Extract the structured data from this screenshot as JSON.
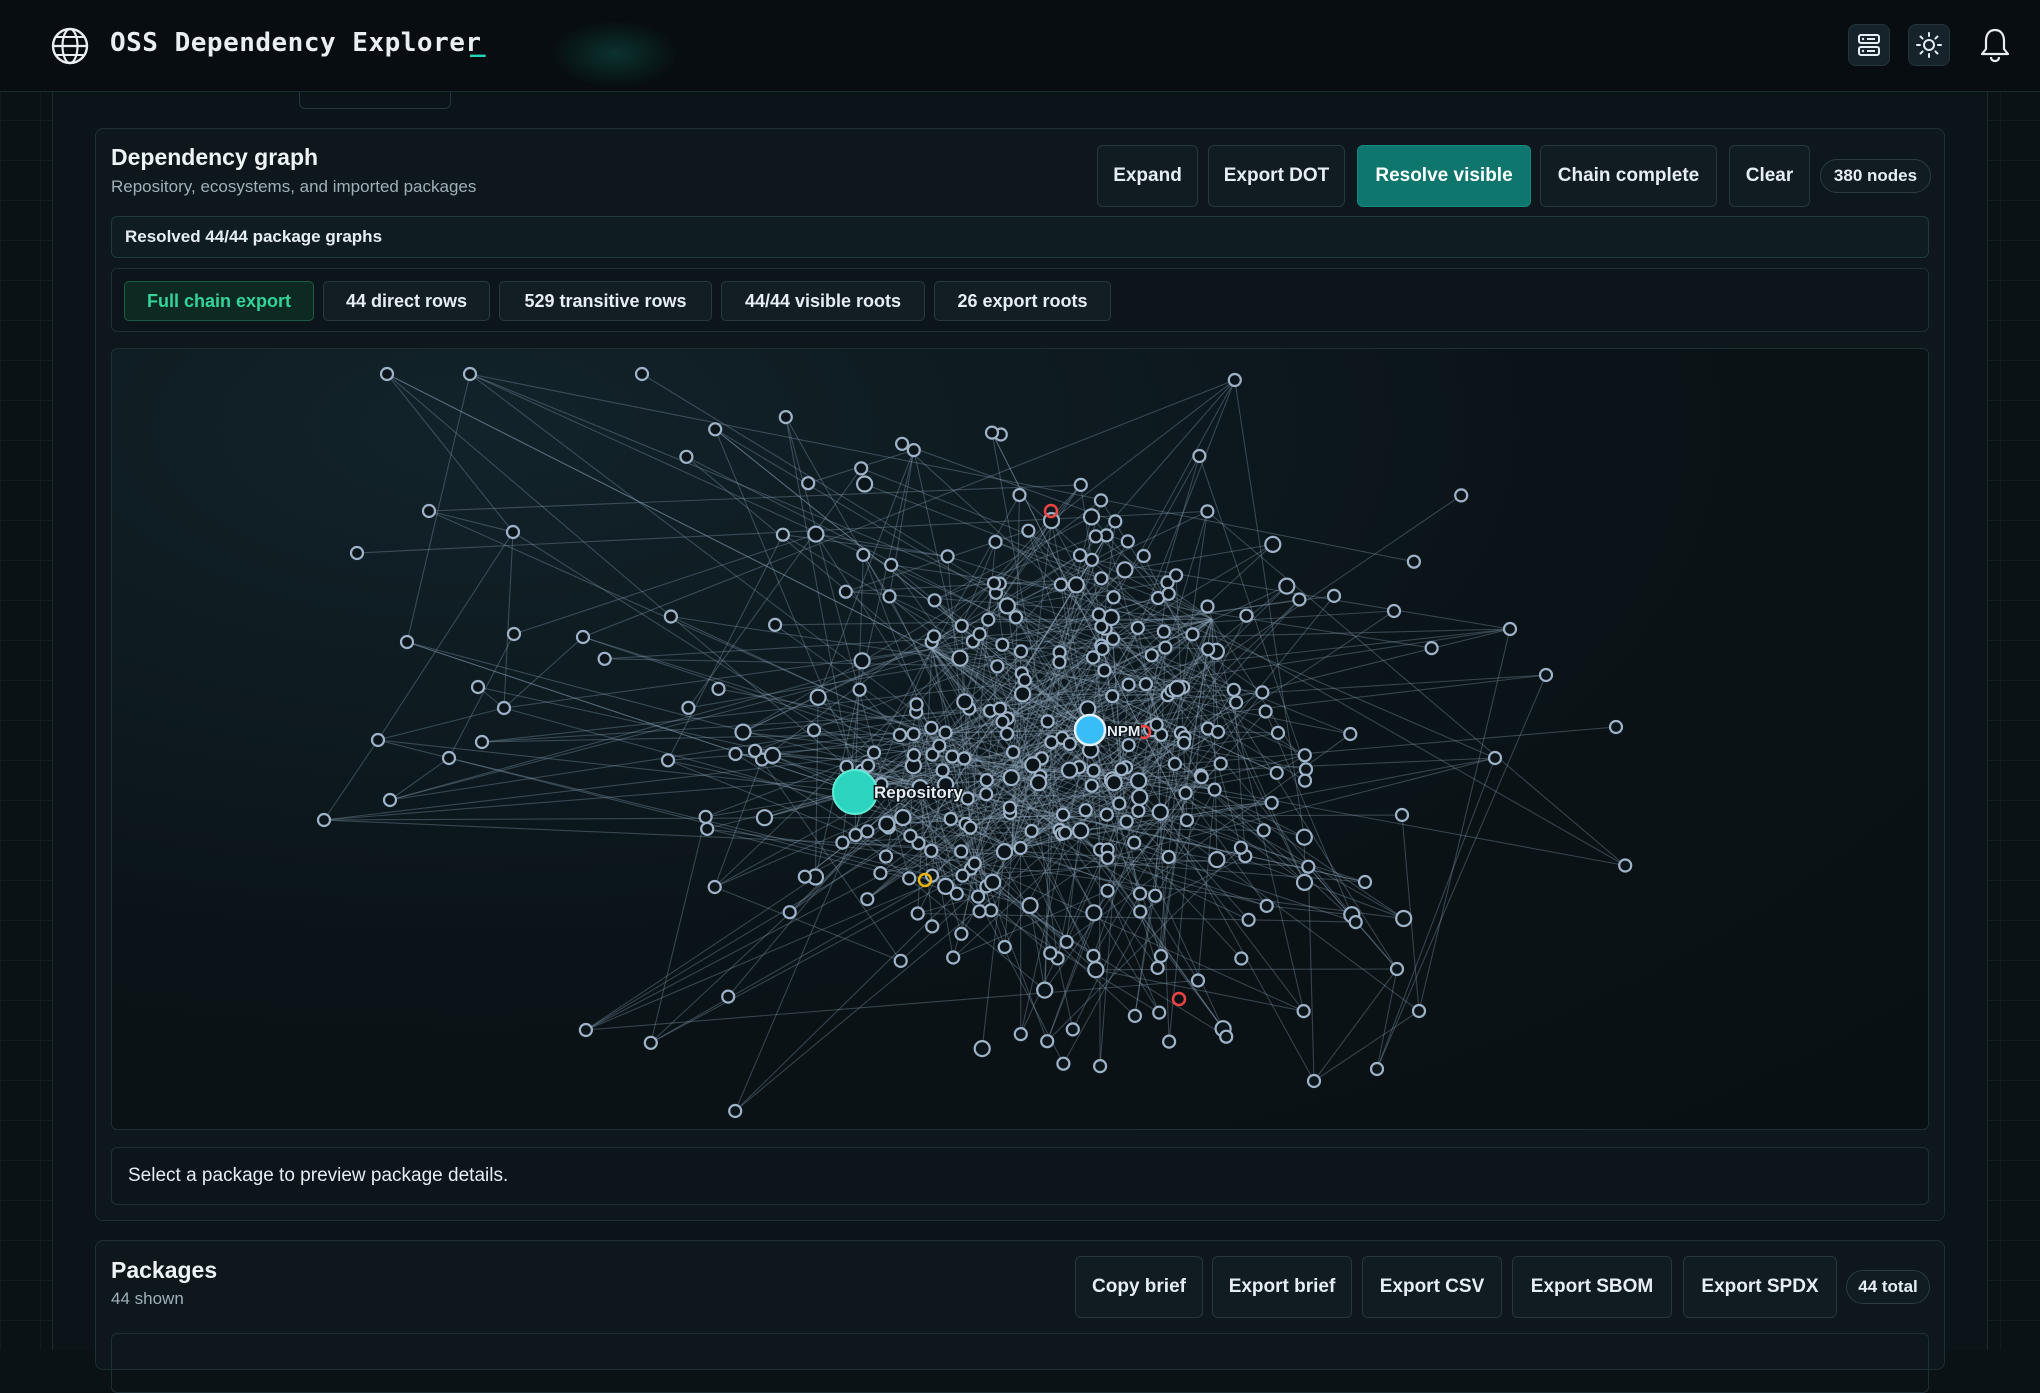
{
  "app": {
    "title": "OSS Dependency Explorer",
    "cursor": "_"
  },
  "header_icons": [
    "globe-icon",
    "server-icon",
    "sun-icon",
    "bell-icon"
  ],
  "graph_panel": {
    "title": "Dependency graph",
    "subtitle": "Repository, ecosystems, and imported packages",
    "buttons": {
      "expand": "Expand",
      "export_dot": "Export DOT",
      "resolve_visible": "Resolve visible",
      "chain_complete": "Chain complete",
      "clear": "Clear"
    },
    "node_count": "380 nodes",
    "status": "Resolved 44/44 package graphs",
    "chips": {
      "full_chain": "Full chain export",
      "direct": "44 direct rows",
      "transitive": "529 transitive rows",
      "visible_roots": "44/44 visible roots",
      "export_roots": "26 export roots"
    },
    "labels": {
      "repository": "Repository",
      "npm": "NPM"
    },
    "detail_hint": "Select a package to preview package details."
  },
  "packages_panel": {
    "title": "Packages",
    "subtitle": "44 shown",
    "buttons": {
      "copy_brief": "Copy brief",
      "export_brief": "Export brief",
      "export_csv": "Export CSV",
      "export_sbom": "Export SBOM",
      "export_spdx": "Export SPDX"
    },
    "total": "44 total"
  },
  "colors": {
    "accent": "#0f766e",
    "repository_node": "#2dd4bf",
    "ecosystem_node": "#38bdf8",
    "vulnerable_node": "#ef4444",
    "warning_node": "#eab308",
    "package_node": "#9fb3c8"
  }
}
